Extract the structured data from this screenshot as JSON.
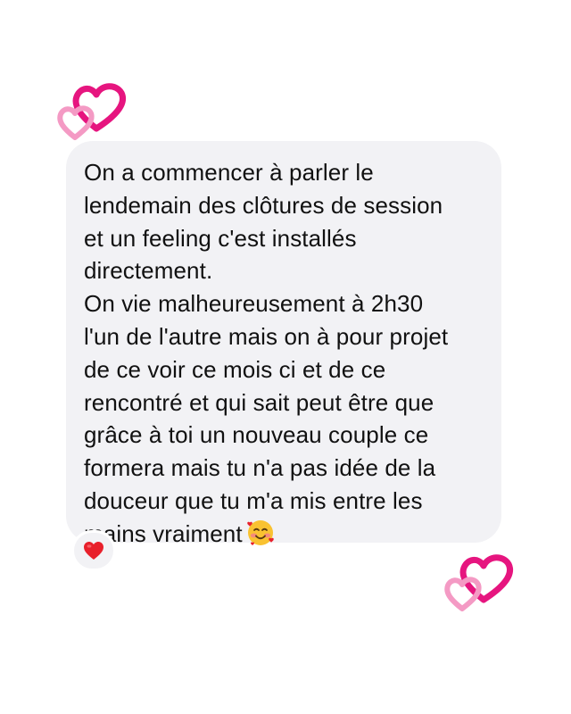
{
  "message": {
    "paragraph_1": "On a commencer à parler le\nlendemain des clôtures de session\net un feeling c'est installés\ndirectement.",
    "paragraph_2": "On vie malheureusement à 2h30\nl'un de l'autre mais on à pour projet\nde ce voir ce mois ci et de ce\nrencontré et qui sait peut être que\ngrâce à toi un nouveau couple ce\nformera mais tu n'a pas idée de la\ndouceur que tu m'a mis entre les\nmains vraiment",
    "trailing_emoji": "smiling-face-with-hearts-icon"
  },
  "reaction": {
    "icon": "red-heart-icon"
  },
  "decorations": {
    "top_left": "double-hearts-icon",
    "bottom_right": "double-hearts-icon"
  },
  "colors": {
    "bubble_background": "#f2f2f5",
    "text": "#111111",
    "heart_magenta": "#e6157f",
    "heart_pink": "#f49ac4",
    "reaction_red": "#e8202b",
    "page_background": "#ffffff"
  }
}
